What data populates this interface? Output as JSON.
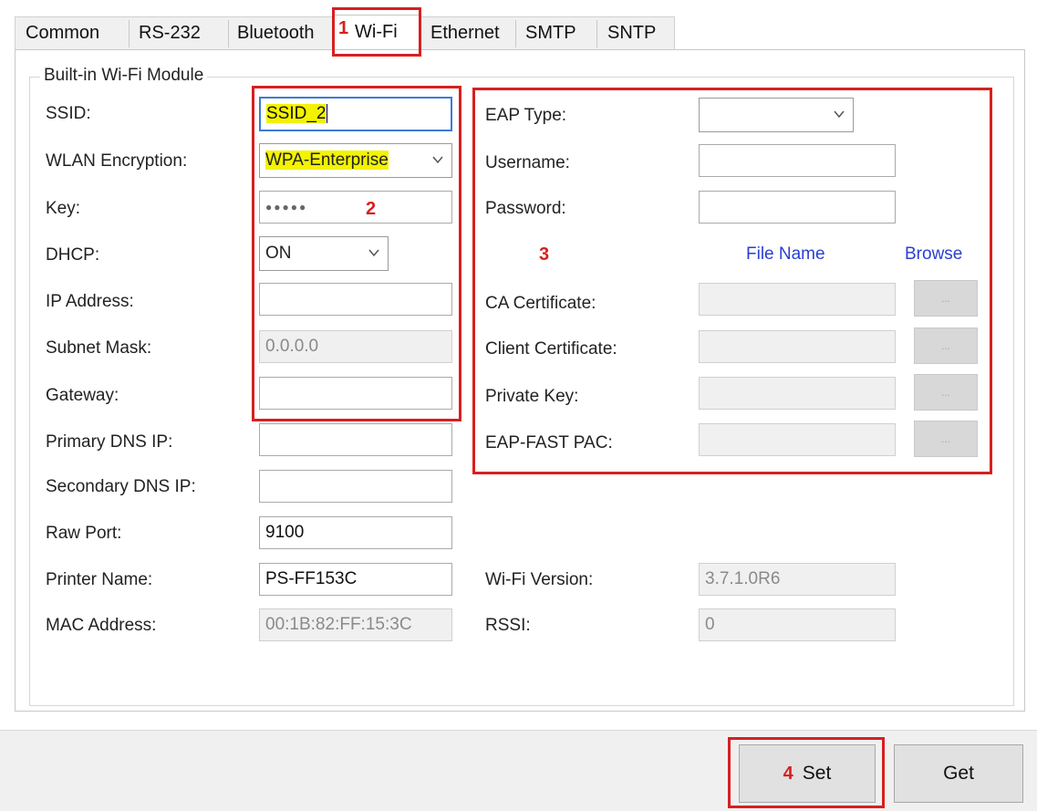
{
  "tabs": [
    "Common",
    "RS-232",
    "Bluetooth",
    "Wi-Fi",
    "Ethernet",
    "SMTP",
    "SNTP"
  ],
  "group_title": "Built-in Wi-Fi Module",
  "left": {
    "ssid_label": "SSID:",
    "ssid_value": "SSID_2",
    "encryption_label": "WLAN Encryption:",
    "encryption_value": "WPA-Enterprise",
    "key_label": "Key:",
    "key_value": "●●●●●",
    "dhcp_label": "DHCP:",
    "dhcp_value": "ON",
    "ip_label": "IP Address:",
    "ip_value": "",
    "subnet_label": "Subnet Mask:",
    "subnet_value": "0.0.0.0",
    "gateway_label": "Gateway:",
    "gateway_value": "",
    "dns1_label": "Primary DNS IP:",
    "dns1_value": "",
    "dns2_label": "Secondary DNS IP:",
    "dns2_value": "",
    "raw_port_label": "Raw Port:",
    "raw_port_value": "9100",
    "printer_name_label": "Printer Name:",
    "printer_name_value": "PS-FF153C",
    "mac_label": "MAC Address:",
    "mac_value": "00:1B:82:FF:15:3C"
  },
  "right": {
    "eap_type_label": "EAP Type:",
    "eap_type_value": "",
    "username_label": "Username:",
    "username_value": "",
    "password_label": "Password:",
    "password_value": "",
    "file_name_header": "File Name",
    "browse_header": "Browse",
    "ca_label": "CA Certificate:",
    "client_label": "Client Certificate:",
    "private_key_label": "Private Key:",
    "eap_fast_label": "EAP-FAST PAC:",
    "browse_btn_label": "...",
    "wifi_version_label": "Wi-Fi Version:",
    "wifi_version_value": "3.7.1.0R6",
    "rssi_label": "RSSI:",
    "rssi_value": "0"
  },
  "buttons": {
    "set": "Set",
    "get": "Get"
  },
  "annotations": [
    "1",
    "2",
    "3",
    "4"
  ],
  "colors": {
    "annotation_red": "#d62020",
    "highlight_yellow": "#f3f300",
    "header_blue": "#2a3fd0"
  }
}
